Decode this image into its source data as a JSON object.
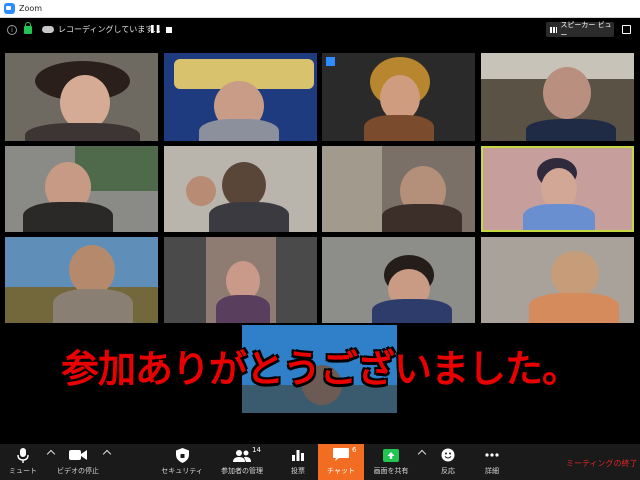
{
  "window": {
    "title": "Zoom"
  },
  "meeting_bar": {
    "info_icon_glyph": "i",
    "recording_text": "レコーディングしています...",
    "pause_glyph": "❚❚",
    "speaker_view_label": "スピーカー ビュー"
  },
  "banner": {
    "text": "参加ありがとうございました。",
    "color": "#e90000"
  },
  "toolbar": {
    "mute_label": "ミュート",
    "video_label": "ビデオの停止",
    "security_label": "セキュリティ",
    "participants_label": "参加者の管理",
    "participants_count": "14",
    "polling_label": "投票",
    "chat_label": "チャット",
    "chat_count": "6",
    "share_label": "画面を共有",
    "reactions_label": "反応",
    "more_label": "詳細",
    "end_label": "ミーティングの終了"
  },
  "colors": {
    "accent": "#2d8cff",
    "chat": "#f26d21",
    "share": "#23c552",
    "end": "#e02828",
    "active_speaker": "#c6d841"
  }
}
